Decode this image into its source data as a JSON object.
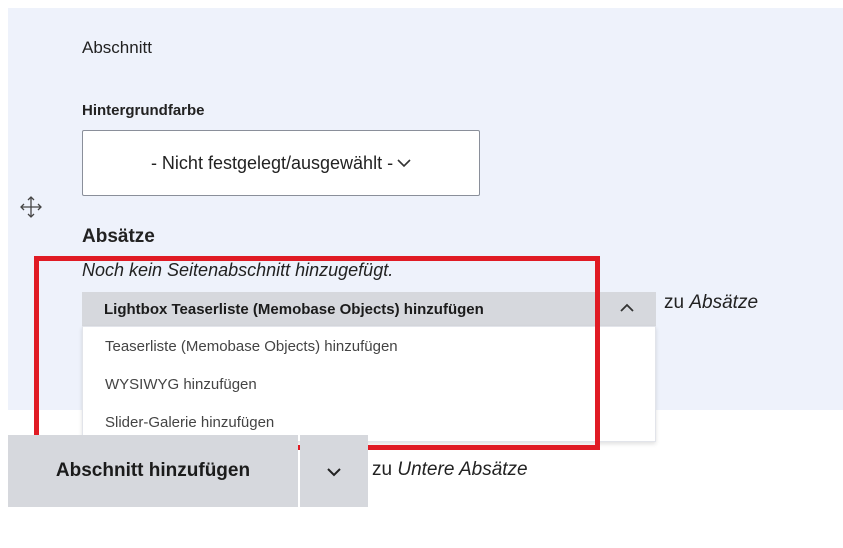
{
  "section": {
    "label": "Abschnitt"
  },
  "background": {
    "label": "Hintergrundfarbe",
    "selected": "- Nicht festgelegt/ausgewählt -",
    "chevron": "chevron-down-icon"
  },
  "move_handle": {
    "icon": "move-icon"
  },
  "absaetze": {
    "heading": "Absätze",
    "empty_text": "Noch kein Seitenabschnitt hinzugefügt.",
    "dropdown": {
      "primary_label": "Lightbox Teaserliste (Memobase Objects) hinzufügen",
      "toggle_icon": "chevron-up-icon",
      "items": [
        {
          "label": "Teaserliste (Memobase Objects) hinzufügen"
        },
        {
          "label": "WYSIWYG hinzufügen"
        },
        {
          "label": "Slider-Galerie hinzufügen"
        }
      ]
    },
    "target_prefix": "zu",
    "target_name": "Absätze"
  },
  "add_section": {
    "button_label": "Abschnitt hinzufügen",
    "toggle_icon": "chevron-down-icon",
    "target_prefix": "zu",
    "target_name": "Untere Absätze"
  },
  "colors": {
    "panel_bg": "#eef2fb",
    "button_bg": "#d6d8dd",
    "highlight_frame": "#e01b24"
  }
}
